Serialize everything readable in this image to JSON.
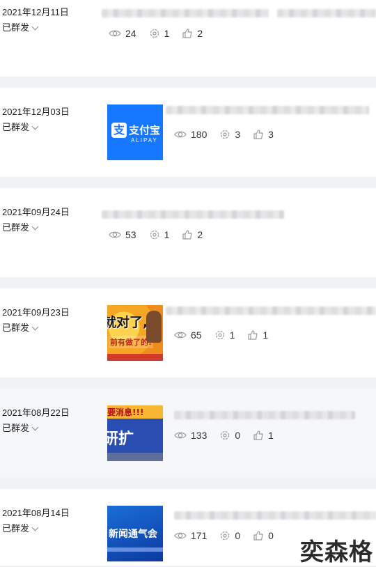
{
  "posts": [
    {
      "date": "2021年12月11日",
      "status": "已群发",
      "views": "24",
      "shares": "1",
      "likes": "2",
      "thumb": null
    },
    {
      "date": "2021年12月03日",
      "status": "已群发",
      "views": "180",
      "shares": "3",
      "likes": "3",
      "thumb": "alipay-logo"
    },
    {
      "date": "2021年09月24日",
      "status": "已群发",
      "views": "53",
      "shares": "1",
      "likes": "2",
      "thumb": null
    },
    {
      "date": "2021年09月23日",
      "status": "已群发",
      "views": "65",
      "shares": "1",
      "likes": "1",
      "thumb": "promo-cartoon"
    },
    {
      "date": "2021年08月22日",
      "status": "已群发",
      "views": "133",
      "shares": "0",
      "likes": "1",
      "thumb": "news-banner"
    },
    {
      "date": "2021年08月14日",
      "status": "已群发",
      "views": "171",
      "shares": "0",
      "likes": "0",
      "thumb": "news-conference"
    }
  ],
  "thumbs": {
    "alipay": {
      "mark": "支",
      "cn": "支付宝",
      "en": "ALIPAY"
    },
    "promo": {
      "line1": "就对了,",
      "line2": "前有做了的!"
    },
    "news1": {
      "top": "要消息!!!",
      "big": "研扩"
    },
    "news2": {
      "big": "新闻通气会"
    }
  },
  "watermark": "奕森格",
  "colors": {
    "page_bg": "#f1f2f4",
    "card_bg": "#ffffff",
    "icon": "#9a9a9a"
  }
}
